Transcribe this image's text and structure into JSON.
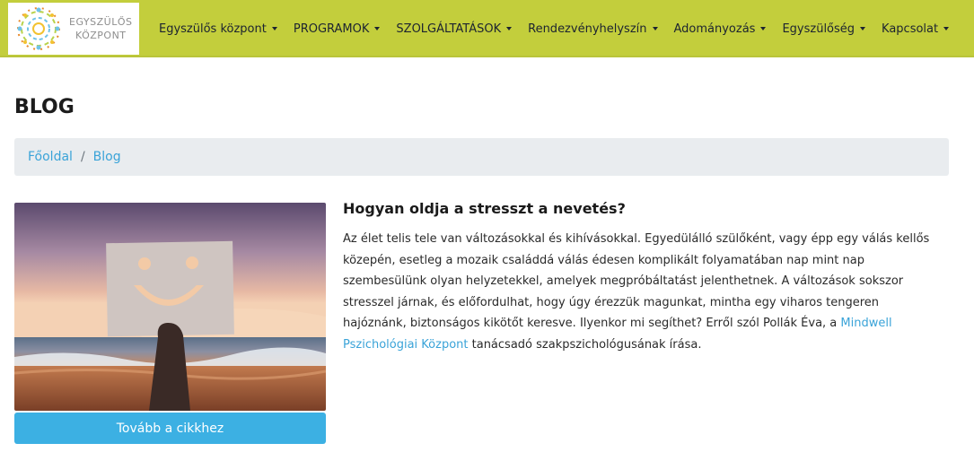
{
  "brand": {
    "logo_line1": "EGYSZÜLŐS",
    "logo_line2": "KÖZPONT"
  },
  "nav": {
    "items": [
      {
        "label": "Egyszülős központ"
      },
      {
        "label": "PROGRAMOK"
      },
      {
        "label": "SZOLGÁLTATÁSOK"
      },
      {
        "label": "Rendezvényhelyszín"
      },
      {
        "label": "Adományozás"
      },
      {
        "label": "Egyszülőség"
      },
      {
        "label": "Kapcsolat"
      }
    ]
  },
  "page": {
    "title": "BLOG"
  },
  "breadcrumb": {
    "home": "Főoldal",
    "separator": "/",
    "current": "Blog"
  },
  "article": {
    "title": "Hogyan oldja a stresszt a nevetés?",
    "body_before_link": "Az élet telis tele van változásokkal és kihívásokkal. Egyedülálló szülőként, vagy épp egy válás kellős közepén, esetleg a mozaik családdá válás édesen komplikált folyamatában nap mint nap szembesülünk olyan helyzetekkel, amelyek megpróbáltatást jelenthetnek. A változások sokszor stresszel járnak, és előfordulhat, hogy úgy érezzük magunkat, mintha egy viharos tengeren hajóznánk, biztonságos kikötőt keresve. Ilyenkor mi segíthet? Erről szól Pollák Éva, a ",
    "link_text": "Mindwell Pszichológiai Központ",
    "body_after_link": " tanácsadó szakpszichológusának írása.",
    "read_more": "Tovább a cikkhez"
  },
  "colors": {
    "navbar": "#c3ce3c",
    "link": "#3aa3d8",
    "button": "#3cb0e3",
    "breadcrumb_bg": "#e9ecef"
  }
}
